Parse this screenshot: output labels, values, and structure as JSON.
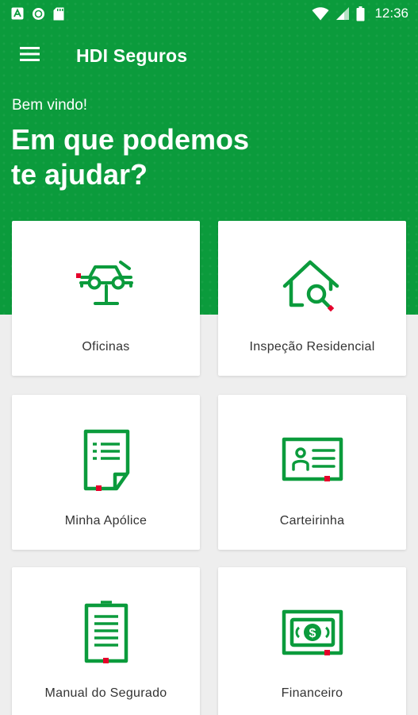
{
  "status_bar": {
    "time": "12:36",
    "left_icons": [
      "text-a-icon",
      "circle-record-icon",
      "sd-card-icon"
    ],
    "right_icons": [
      "wifi-icon",
      "cell-signal-icon",
      "battery-icon"
    ]
  },
  "app_bar": {
    "title": "HDI Seguros",
    "menu_icon": "hamburger-menu-icon"
  },
  "hero": {
    "greeting": "Bem vindo!",
    "headline_line1": "Em que podemos",
    "headline_line2": "te ajudar?"
  },
  "cards": [
    {
      "label": "Oficinas",
      "icon": "car-lift-icon"
    },
    {
      "label": "Inspeção Residencial",
      "icon": "house-search-icon"
    },
    {
      "label": "Minha Apólice",
      "icon": "policy-document-icon"
    },
    {
      "label": "Carteirinha",
      "icon": "id-card-icon"
    },
    {
      "label": "Manual do Segurado",
      "icon": "manual-document-icon"
    },
    {
      "label": "Financeiro",
      "icon": "money-bill-icon"
    }
  ],
  "colors": {
    "brand_green": "#0b9b3c",
    "accent_red": "#e5002b",
    "card_bg": "#ffffff",
    "page_bg": "#eeeeee"
  }
}
